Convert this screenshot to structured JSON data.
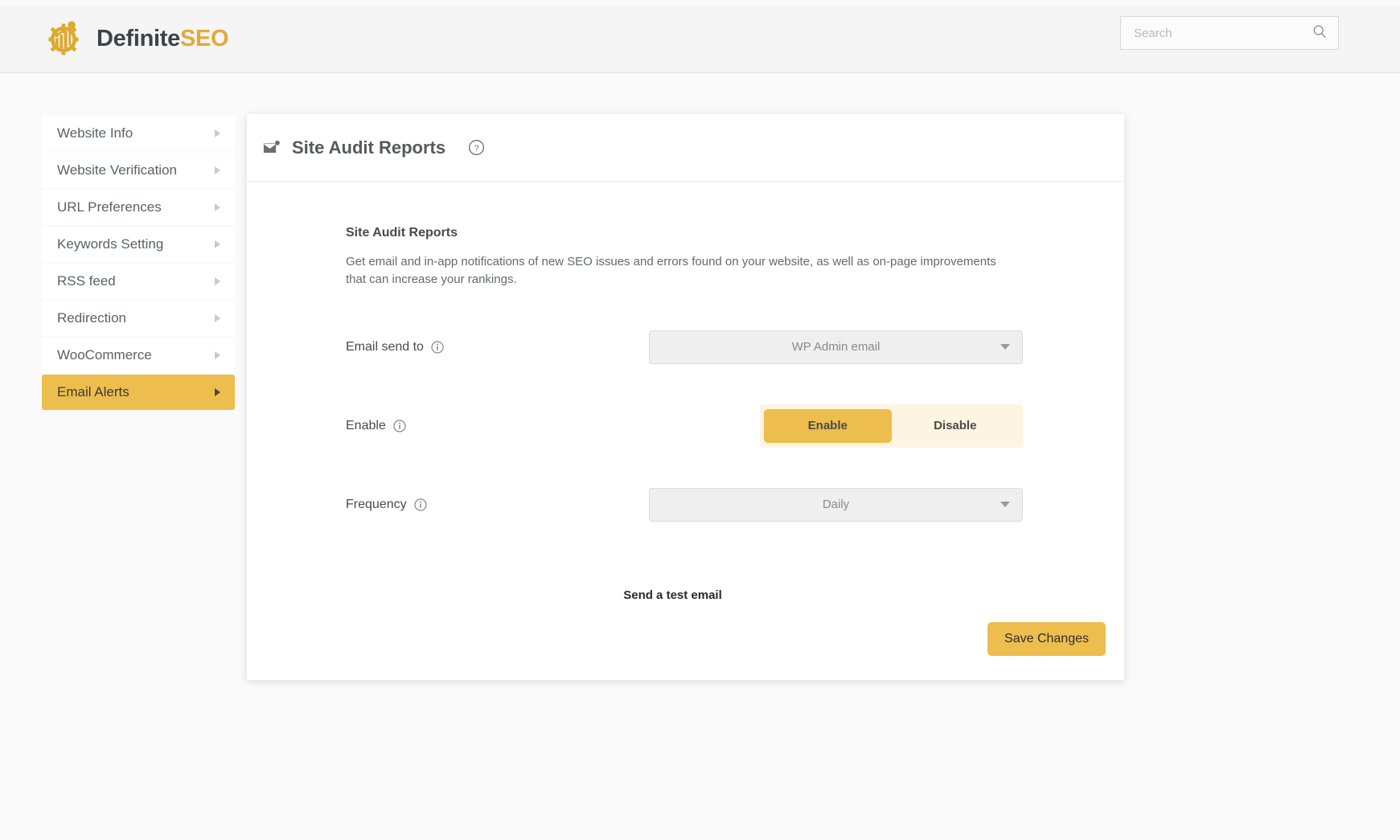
{
  "brand": {
    "name_primary": "Definite",
    "name_accent": "SEO",
    "logo_icon": "gear-chart-logo",
    "accent_color": "#e2a93a",
    "text_color": "#3b4449"
  },
  "search": {
    "placeholder": "Search",
    "value": "",
    "icon": "search-icon"
  },
  "sidebar": {
    "items": [
      {
        "label": "Website Info",
        "active": false,
        "caret": "chevron-right-icon"
      },
      {
        "label": "Website Verification",
        "active": false,
        "caret": "chevron-right-icon"
      },
      {
        "label": "URL Preferences",
        "active": false,
        "caret": "chevron-right-icon"
      },
      {
        "label": "Keywords Setting",
        "active": false,
        "caret": "chevron-right-icon"
      },
      {
        "label": "RSS feed",
        "active": false,
        "caret": "chevron-right-icon"
      },
      {
        "label": "Redirection",
        "active": false,
        "caret": "chevron-right-icon"
      },
      {
        "label": "WooCommerce",
        "active": false,
        "caret": "chevron-right-icon"
      },
      {
        "label": "Email Alerts",
        "active": true,
        "caret": "chevron-right-icon"
      }
    ],
    "active_bg": "#edbe4d"
  },
  "card": {
    "header": {
      "icon": "envelope-icon",
      "title": "Site Audit Reports",
      "help_icon": "question-circle-icon"
    },
    "section": {
      "title": "Site Audit Reports",
      "description": "Get email and in-app notifications of new SEO issues and errors found on your website, as well as on-page improvements that can increase your rankings."
    },
    "fields": {
      "email_send_to": {
        "label": "Email send to",
        "info_icon": "info-circle-icon",
        "value": "WP Admin email",
        "caret": "caret-down-icon"
      },
      "enable": {
        "label": "Enable",
        "info_icon": "info-circle-icon",
        "options": [
          "Enable",
          "Disable"
        ],
        "selected": "Enable",
        "active_color": "#edbe4d",
        "track_color": "#fdf4e2"
      },
      "frequency": {
        "label": "Frequency",
        "info_icon": "info-circle-icon",
        "value": "Daily",
        "caret": "caret-down-icon"
      }
    },
    "test_email_label": "Send a test email",
    "save_label": "Save Changes"
  }
}
